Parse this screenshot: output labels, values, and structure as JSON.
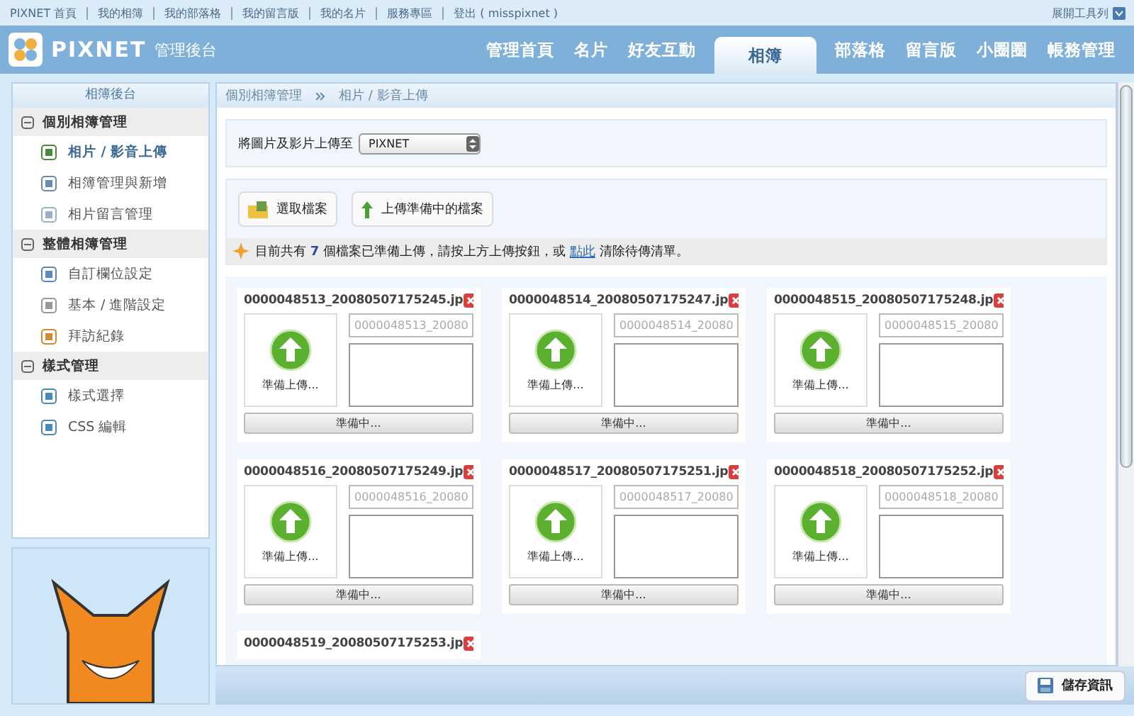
{
  "top_links": [
    "PIXNET 首頁",
    "我的相簿",
    "我的部落格",
    "我的留言版",
    "我的名片",
    "服務專區",
    "登出 ( misspixnet )"
  ],
  "toolbar_toggle": "展開工具列",
  "logo": {
    "brand": "PIXNET",
    "subtitle": "管理後台"
  },
  "tabs": [
    {
      "label": "管理首頁",
      "selected": false
    },
    {
      "label": "名片",
      "selected": false
    },
    {
      "label": "好友互動",
      "selected": false
    },
    {
      "label": "相簿",
      "selected": true
    },
    {
      "label": "部落格",
      "selected": false
    },
    {
      "label": "留言版",
      "selected": false
    },
    {
      "label": "小圈圈",
      "selected": false
    },
    {
      "label": "帳務管理",
      "selected": false
    }
  ],
  "sidebar": {
    "title": "相簿後台",
    "sections": [
      {
        "label": "個別相簿管理",
        "expanded": true,
        "items": [
          {
            "label": "相片 / 影音上傳",
            "selected": true
          },
          {
            "label": "相簿管理與新增",
            "selected": false
          },
          {
            "label": "相片留言管理",
            "selected": false
          }
        ]
      },
      {
        "label": "整體相簿管理",
        "expanded": true,
        "items": [
          {
            "label": "自訂欄位設定",
            "selected": false
          },
          {
            "label": "基本 / 進階設定",
            "selected": false
          },
          {
            "label": "拜訪紀錄",
            "selected": false
          }
        ]
      },
      {
        "label": "樣式管理",
        "expanded": true,
        "items": [
          {
            "label": "樣式選擇",
            "selected": false
          },
          {
            "label": "CSS 編輯",
            "selected": false
          }
        ]
      }
    ]
  },
  "breadcrumb": [
    "個別相簿管理",
    "相片 / 影音上傳"
  ],
  "destination": {
    "label": "將圖片及影片上傳至",
    "value": "PIXNET"
  },
  "buttons": [
    {
      "label": "選取檔案",
      "kind": "folder"
    },
    {
      "label": "上傳準備中的檔案",
      "kind": "upload"
    }
  ],
  "notice": {
    "before": "目前共有",
    "count": "7",
    "middle": "個檔案已準備上傳，請按上方上傳按鈕，或",
    "link": "點此",
    "after": "清除待傳清單。"
  },
  "files": [
    {
      "name": "0000048513_20080507175245.jp",
      "title": "0000048513_20080",
      "status": "準備上傳...",
      "button": "準備中..."
    },
    {
      "name": "0000048514_20080507175247.jp",
      "title": "0000048514_20080",
      "status": "準備上傳...",
      "button": "準備中..."
    },
    {
      "name": "0000048515_20080507175248.jp",
      "title": "0000048515_20080",
      "status": "準備上傳...",
      "button": "準備中..."
    },
    {
      "name": "0000048516_20080507175249.jp",
      "title": "0000048516_20080",
      "status": "準備上傳...",
      "button": "準備中..."
    },
    {
      "name": "0000048517_20080507175251.jp",
      "title": "0000048517_20080",
      "status": "準備上傳...",
      "button": "準備中..."
    },
    {
      "name": "0000048518_20080507175252.jp",
      "title": "0000048518_20080",
      "status": "準備上傳...",
      "button": "準備中..."
    },
    {
      "name": "0000048519_20080507175253.jp"
    }
  ],
  "save_button": "儲存資訊"
}
